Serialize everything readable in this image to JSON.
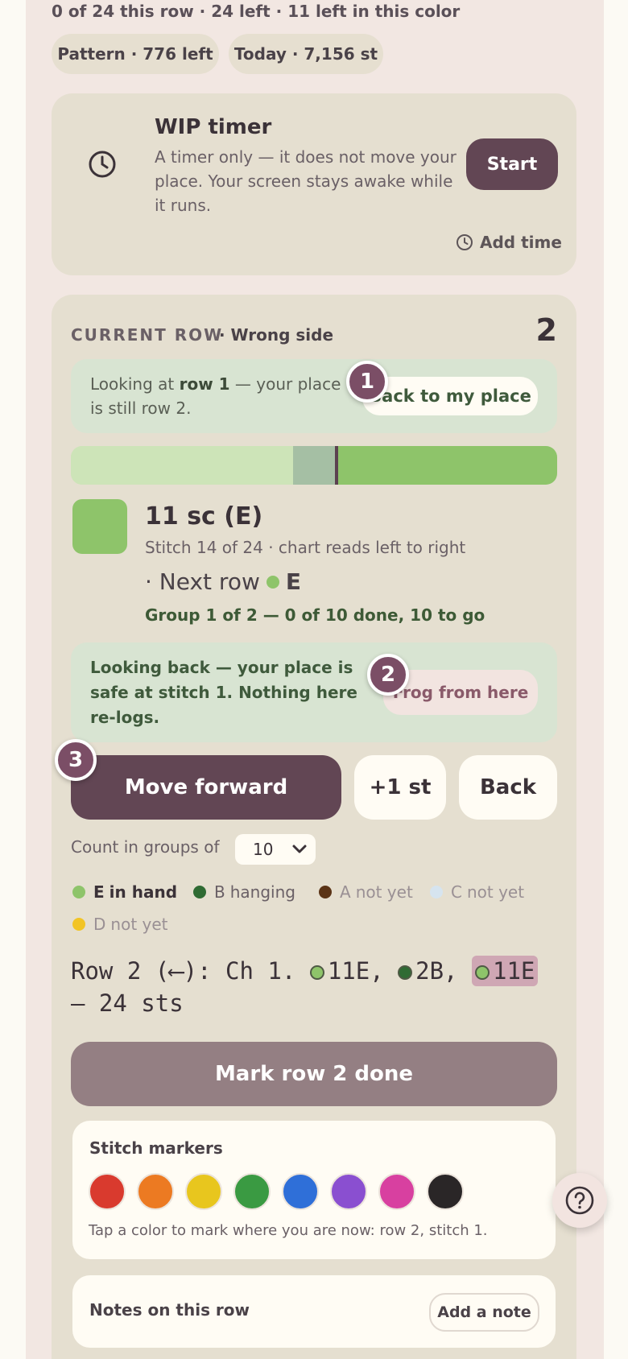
{
  "summary": {
    "row_progress": "0 of 24 this row · 24 left · 11 left in this color",
    "pattern_pill": "Pattern · 776 left",
    "today_pill": "Today · 7,156 st"
  },
  "timer": {
    "title": "WIP timer",
    "description": "A timer only — it does not move your place. Your screen stays awake while it runs.",
    "start_label": "Start",
    "add_time_label": "Add time"
  },
  "current_row": {
    "label": "CURRENT ROW",
    "side": "· Wrong side",
    "number": "2",
    "looking_prefix": "Looking at ",
    "looking_row": "row 1",
    "looking_suffix": " — your place is still row 2.",
    "back_to_place_label": "Back to my place",
    "progress": {
      "stitch_index": 14,
      "total": 24
    },
    "stitch_title": "11 sc (E)",
    "stitch_sub": "Stitch 14 of 24 · chart reads left to right",
    "next_row_prefix": "· Next row",
    "next_row_color": "E",
    "group_line": "Group 1 of 2 — 0 of 10 done, 10 to go",
    "looking_back_text": "Looking back — your place is safe at stitch 1. Nothing here re-logs.",
    "frog_label": "Frog from here",
    "move_forward_label": "Move forward",
    "plus_one_label": "+1 st",
    "back_label": "Back",
    "groups_label": "Count in groups of",
    "groups_value": "10",
    "mark_done_label": "Mark row 2 done"
  },
  "badges": [
    "1",
    "2",
    "3"
  ],
  "legend": [
    {
      "key": "E",
      "text": "in hand",
      "color": "#8ec46a"
    },
    {
      "key": "B",
      "text": "hanging",
      "color": "#2f6b33"
    },
    {
      "key": "A",
      "text": "not yet",
      "color": "#5b3416"
    },
    {
      "key": "C",
      "text": "not yet",
      "color": "#d6e4ef"
    },
    {
      "key": "D",
      "text": "not yet",
      "color": "#f2c425"
    }
  ],
  "pattern": {
    "prefix": "Row 2 (⟵): Ch 1.",
    "part1": "11E,",
    "part2": "2B,",
    "part3": "11E",
    "suffix": "— 24 sts"
  },
  "markers": {
    "title": "Stitch markers",
    "colors": [
      "#d93a2e",
      "#ec7a22",
      "#e8c61e",
      "#3a9a42",
      "#2f6fd8",
      "#8a4fd0",
      "#d840a0",
      "#2a2627"
    ],
    "hint": "Tap a color to mark where you are now: row 2, stitch 1."
  },
  "notes": {
    "title": "Notes on this row",
    "add_label": "Add a note"
  },
  "colors": {
    "accent": "#624654",
    "color_e": "#8ec46a",
    "color_b": "#2f6b33"
  },
  "icons": {
    "clock": "clock-icon",
    "help": "help-icon",
    "chevron": "chevron-down-icon"
  }
}
